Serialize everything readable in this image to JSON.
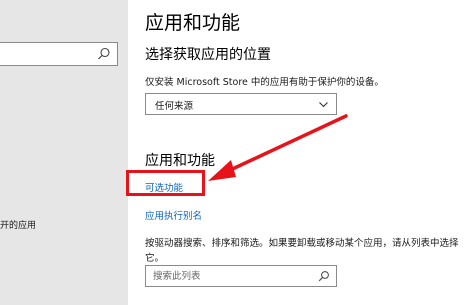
{
  "sidebar": {
    "search_icon": "search-icon",
    "partial_item_label": "开的应用"
  },
  "main": {
    "page_title": "应用和功能",
    "install_section": {
      "title": "选择获取应用的位置",
      "description": "仅安装 Microsoft Store 中的应用有助于保护你的设备。",
      "dropdown_value": "任何来源",
      "dropdown_icon": "chevron-down-icon"
    },
    "apps_section": {
      "title": "应用和功能",
      "optional_features_link": "可选功能",
      "app_aliases_link": "应用执行别名",
      "description": "按驱动器搜索、排序和筛选。如果要卸载或移动某个应用，请从列表中选择它。",
      "search_placeholder": "搜索此列表",
      "search_icon": "search-icon"
    }
  },
  "annotation": {
    "color": "#e8131a",
    "shape": "arrow-and-box"
  },
  "colors": {
    "link": "#0a63c7",
    "sidebar_bg": "#e6e6e6"
  }
}
